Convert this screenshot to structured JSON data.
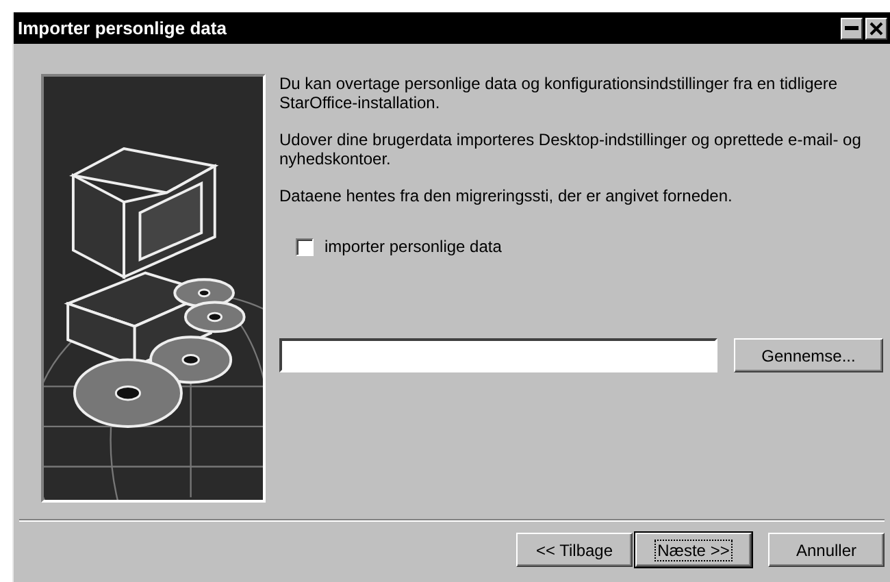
{
  "window": {
    "title": "Importer personlige data"
  },
  "paragraphs": [
    "Du kan overtage personlige data og konfigurationsindstillinger fra en tidligere StarOffice-installation.",
    "Udover dine brugerdata importeres Desktop-indstillinger og oprettede e-mail- og nyhedskontoer.",
    "Dataene hentes fra den migreringssti, der er angivet forneden."
  ],
  "checkbox": {
    "label": "importer personlige data",
    "checked": false
  },
  "browse_button": {
    "label": "Gennemse..."
  },
  "buttons": [
    {
      "label": "<< Tilbage",
      "focused": false
    },
    {
      "label": "Næste >>",
      "focused": true
    },
    {
      "label": "Annuller",
      "focused": false
    }
  ]
}
